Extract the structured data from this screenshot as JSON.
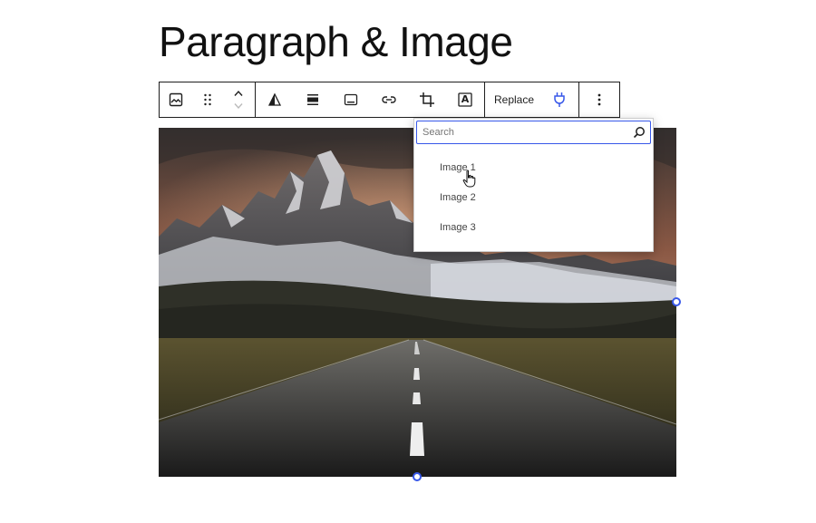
{
  "page": {
    "title": "Paragraph & Image"
  },
  "toolbar": {
    "icons": [
      "image-icon",
      "drag-handle-icon",
      "move-up-icon",
      "move-down-icon",
      "duotone-icon",
      "align-icon",
      "caption-icon",
      "link-icon",
      "crop-icon",
      "text-overlay-icon",
      "replace-icon",
      "more-options-icon"
    ],
    "replace_label": "Replace",
    "text_overlay_letter": "A"
  },
  "dropdown": {
    "search_placeholder": "Search",
    "options": [
      {
        "label": "Image 1"
      },
      {
        "label": "Image 2"
      },
      {
        "label": "Image 3"
      }
    ]
  },
  "colors": {
    "accent": "#3858e9",
    "border": "#1e1e1e"
  }
}
